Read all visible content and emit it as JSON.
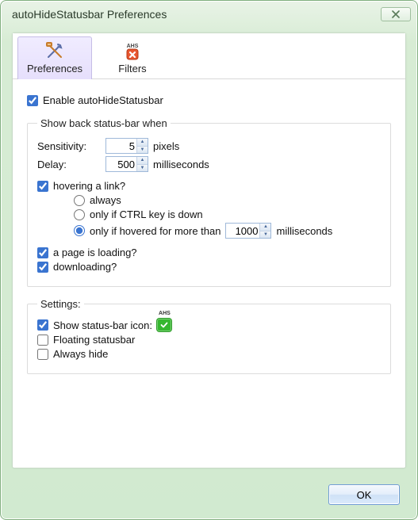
{
  "window": {
    "title": "autoHideStatusbar Preferences"
  },
  "tabs": {
    "preferences": "Preferences",
    "filters": "Filters"
  },
  "main": {
    "enable_label": "Enable autoHideStatusbar",
    "enable_checked": true
  },
  "showback": {
    "legend": "Show back status-bar when",
    "sensitivity_label": "Sensitivity:",
    "sensitivity_value": "5",
    "sensitivity_unit": "pixels",
    "delay_label": "Delay:",
    "delay_value": "500",
    "delay_unit": "milliseconds",
    "hover": {
      "label": "hovering a link?",
      "checked": true,
      "opt_always": "always",
      "opt_ctrl": "only if CTRL key is down",
      "opt_hovered_prefix": "only if hovered for more than",
      "opt_hovered_value": "1000",
      "opt_hovered_unit": "milliseconds",
      "selected": "hovered"
    },
    "loading": {
      "label": "a page is loading?",
      "checked": true
    },
    "downloading": {
      "label": "downloading?",
      "checked": true
    }
  },
  "settings": {
    "legend": "Settings:",
    "show_icon": {
      "label": "Show status-bar icon:",
      "checked": true
    },
    "floating": {
      "label": "Floating statusbar",
      "checked": false
    },
    "always_hide": {
      "label": "Always hide",
      "checked": false
    }
  },
  "buttons": {
    "ok": "OK"
  }
}
